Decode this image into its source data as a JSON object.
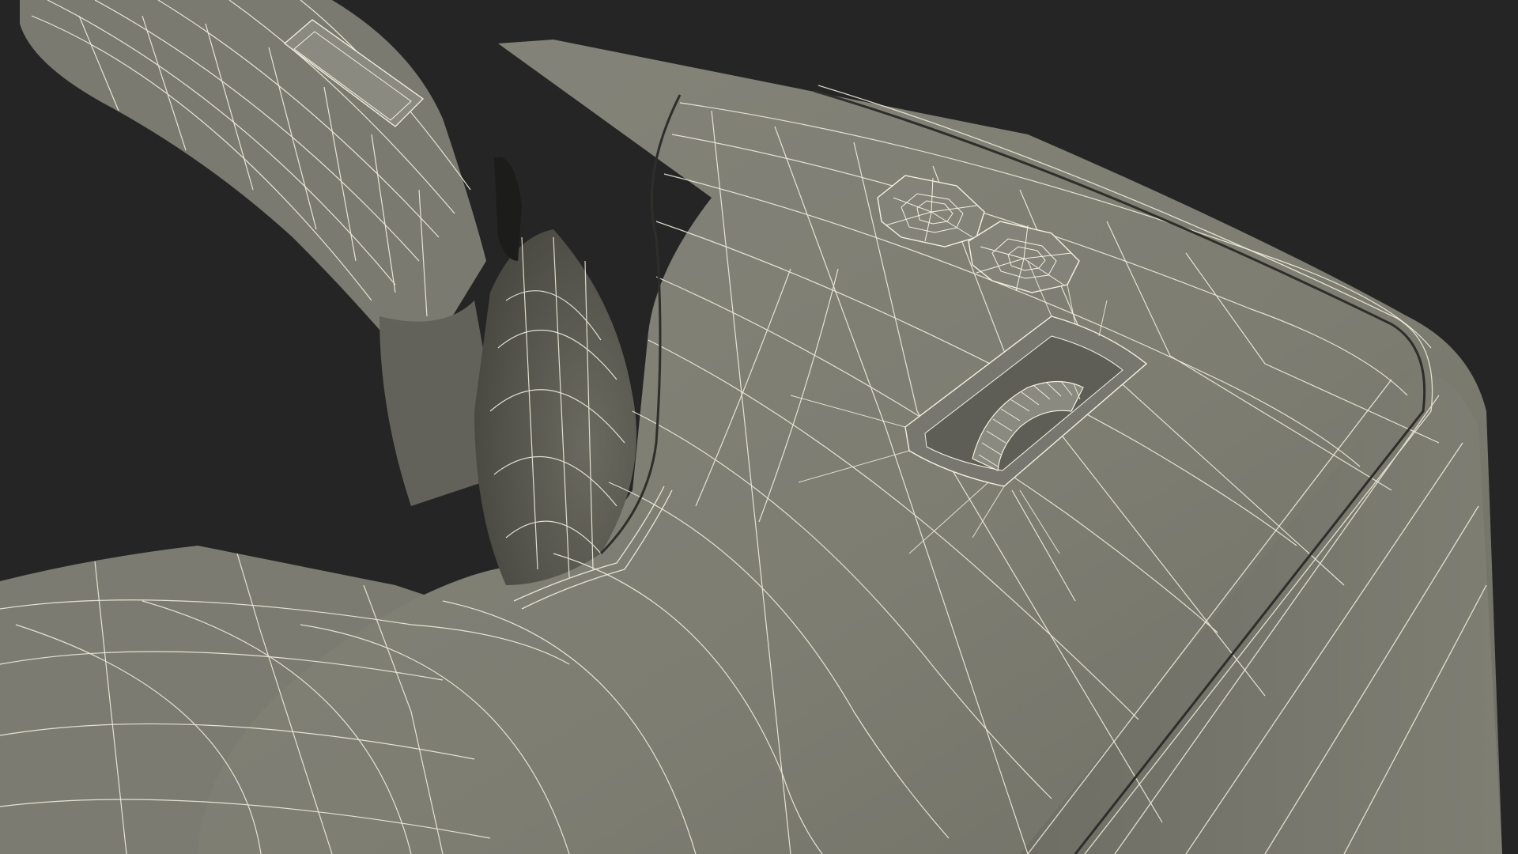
{
  "scene": {
    "subject": "headset-wireframe-render",
    "colors": {
      "background": "#252525",
      "surface": "#7d7d72",
      "surface_shadow": "#54544c",
      "surface_dark": "#3c3c36",
      "wire": "#f4f1de"
    },
    "parts": [
      "head-strap",
      "strap-clip",
      "visor-shell",
      "eye-socket-opening",
      "side-button-upper",
      "side-button-lower",
      "adjustment-wheel",
      "front-lip"
    ]
  }
}
